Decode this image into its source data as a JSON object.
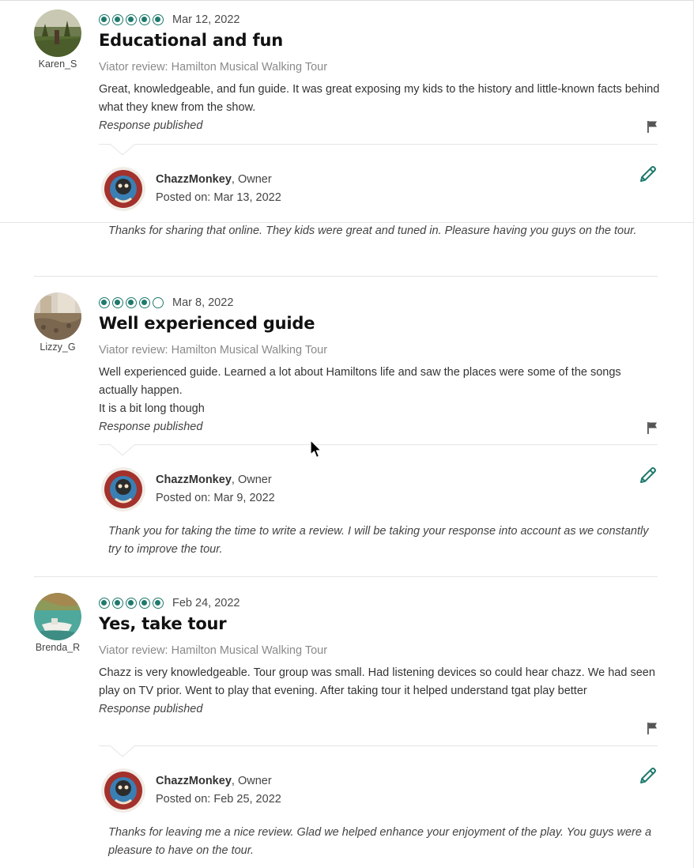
{
  "reviews": [
    {
      "username": "Karen_S",
      "rating": 5,
      "date": "Mar 12, 2022",
      "title": "Educational and fun",
      "source": "Viator review: Hamilton Musical Walking Tour",
      "body_lines": [
        "Great, knowledgeable, and fun guide. It was great exposing my kids to the history and little-known facts behind what they knew from the show."
      ],
      "response_status": "Response published",
      "owner_name": "ChazzMonkey",
      "owner_role": ", Owner",
      "posted_label": "Posted on:",
      "posted_date": "Mar 13, 2022",
      "owner_response": "Thanks for sharing that online. They kids were great and tuned in. Pleasure having you guys on the tour."
    },
    {
      "username": "Lizzy_G",
      "rating": 4,
      "date": "Mar 8, 2022",
      "title": "Well experienced guide",
      "source": "Viator review: Hamilton Musical Walking Tour",
      "body_lines": [
        "Well experienced guide. Learned a lot about Hamiltons life and saw the places were some of the songs actually happen.",
        "It is a bit long though"
      ],
      "response_status": "Response published",
      "owner_name": "ChazzMonkey",
      "owner_role": ", Owner",
      "posted_label": "Posted on:",
      "posted_date": "Mar 9, 2022",
      "owner_response": "Thank you for taking the time to write a review. I will be taking your response into account as we constantly try to improve the tour."
    },
    {
      "username": "Brenda_R",
      "rating": 5,
      "date": "Feb 24, 2022",
      "title": "Yes, take tour",
      "source": "Viator review: Hamilton Musical Walking Tour",
      "body_lines": [
        "Chazz is very knowledgeable. Tour group was small. Had listening devices so could hear chazz. We had seen play on TV prior. Went to play that evening. After taking tour it helped understand tgat play better"
      ],
      "response_status": "Response published",
      "owner_name": "ChazzMonkey",
      "owner_role": ", Owner",
      "posted_label": "Posted on:",
      "posted_date": "Feb 25, 2022",
      "owner_response": "Thanks for leaving me a nice review. Glad we helped enhance your enjoyment of the play. You guys were a pleasure to have on the tour."
    }
  ],
  "colors": {
    "bubble_accent": "#1f7a6c",
    "edit_icon": "#1f7a6c",
    "title_text": "#111111",
    "source_text": "#8a8a8a"
  },
  "icons": {
    "rating": "rating-bubble-icon",
    "flag": "flag-icon",
    "edit": "pencil-icon",
    "cursor": "mouse-pointer-icon"
  }
}
